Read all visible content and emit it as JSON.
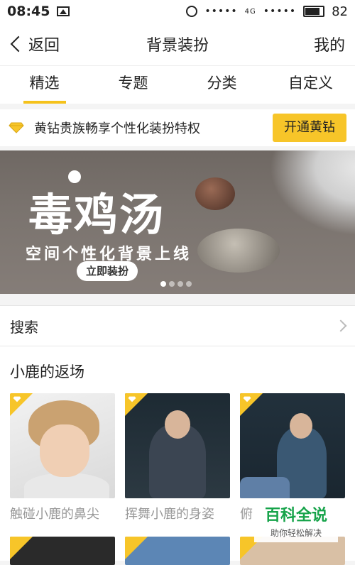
{
  "status": {
    "time": "08:45",
    "signal": "•••••",
    "network": "4G",
    "signal2": "•••••",
    "battery": "82"
  },
  "nav": {
    "back": "返回",
    "title": "背景装扮",
    "right": "我的"
  },
  "tabs": [
    "精选",
    "专题",
    "分类",
    "自定义"
  ],
  "promo": {
    "text": "黄钻贵族畅享个性化装扮特权",
    "button": "开通黄钻"
  },
  "banner": {
    "title": "毒鸡汤",
    "subtitle": "空间个性化背景上线",
    "button": "立即装扮",
    "pages": 4,
    "current": 1
  },
  "search": {
    "label": "搜索"
  },
  "section": {
    "title": "小鹿的返场",
    "items": [
      {
        "caption": "触碰小鹿的鼻尖"
      },
      {
        "caption": "挥舞小鹿的身姿"
      },
      {
        "caption": "俯"
      }
    ]
  },
  "watermark": {
    "title": "百科全说",
    "subtitle": "助你轻松解决"
  },
  "colors": {
    "accent": "#f5c21b",
    "button": "#f7c529"
  },
  "icons": {
    "back": "chevron-left-icon",
    "diamond": "diamond-icon",
    "search_arrow": "chevron-right-icon"
  }
}
